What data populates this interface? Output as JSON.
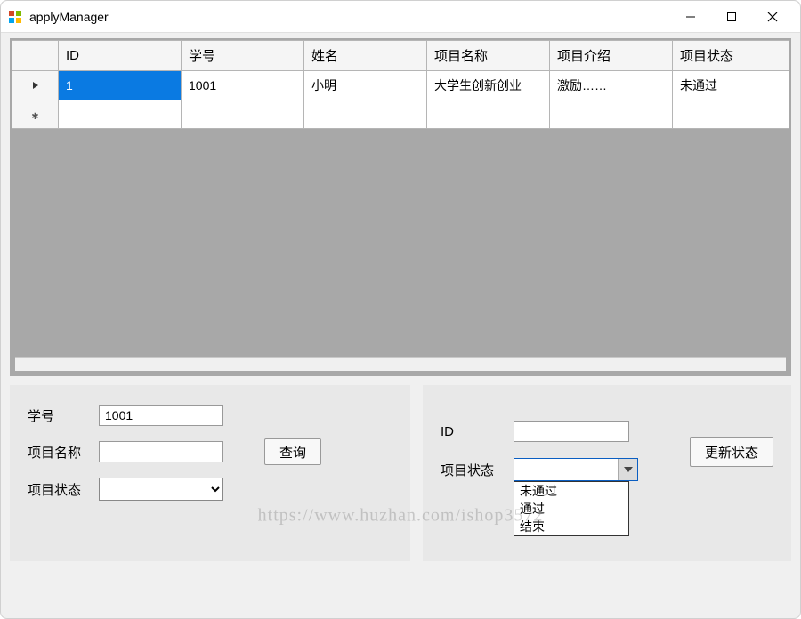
{
  "window": {
    "title": "applyManager"
  },
  "grid": {
    "columns": [
      "ID",
      "学号",
      "姓名",
      "项目名称",
      "项目介绍",
      "项目状态"
    ],
    "rows": [
      {
        "id": "1",
        "sno": "1001",
        "name": "小明",
        "pname": "大学生创新创业",
        "pdesc": "激励……",
        "pstatus": "未通过"
      }
    ]
  },
  "filter": {
    "sno_label": "学号",
    "sno_value": "1001",
    "pname_label": "项目名称",
    "pname_value": "",
    "pstatus_label": "项目状态",
    "pstatus_value": "",
    "query_label": "查询"
  },
  "update": {
    "id_label": "ID",
    "id_value": "",
    "pstatus_label": "项目状态",
    "pstatus_value": "",
    "update_label": "更新状态",
    "options": [
      "未通过",
      "通过",
      "结束"
    ]
  },
  "watermark": "https://www.huzhan.com/ishop3572"
}
